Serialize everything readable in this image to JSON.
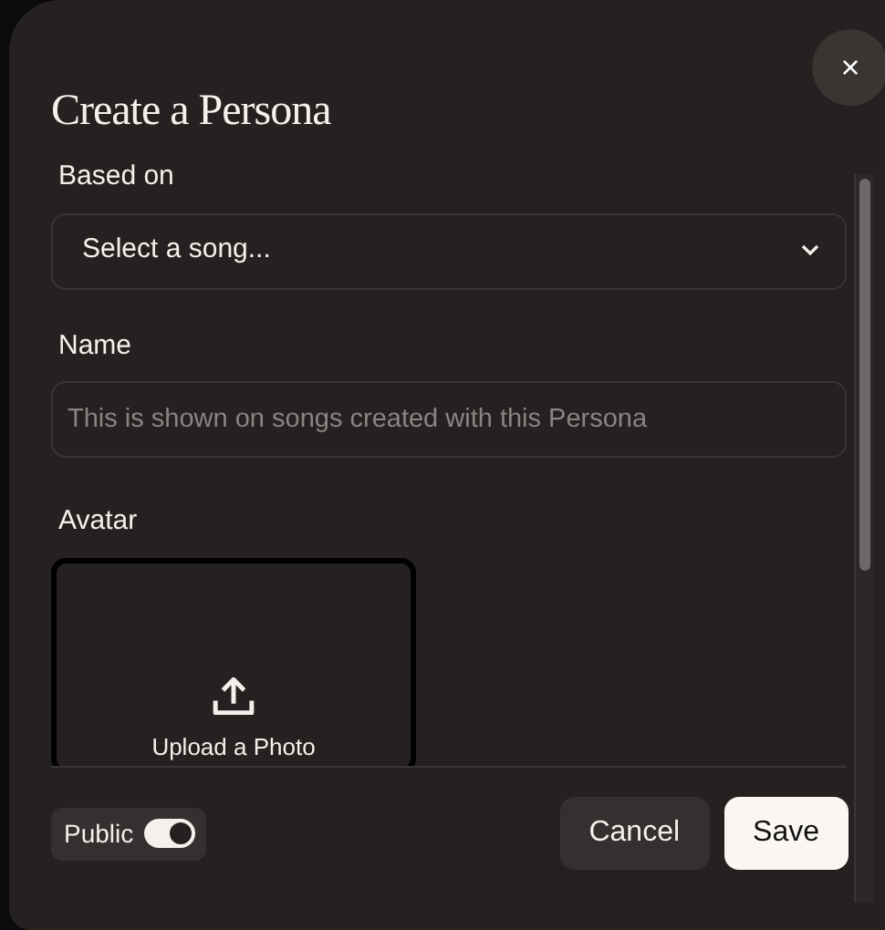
{
  "dialog": {
    "title": "Create a Persona",
    "close_icon": "×"
  },
  "fields": [
    {
      "kind": "select",
      "label": "Based on",
      "value": "Select a song..."
    },
    {
      "kind": "text",
      "label": "Name",
      "placeholder": "This is shown on songs created with this Persona"
    },
    {
      "kind": "upload",
      "label": "Avatar",
      "button": "Upload a Photo"
    }
  ],
  "footer": {
    "toggle": {
      "label": "Public",
      "on": true
    },
    "buttons": [
      {
        "label": "Cancel",
        "kind": "secondary"
      },
      {
        "label": "Save",
        "kind": "primary"
      }
    ]
  }
}
